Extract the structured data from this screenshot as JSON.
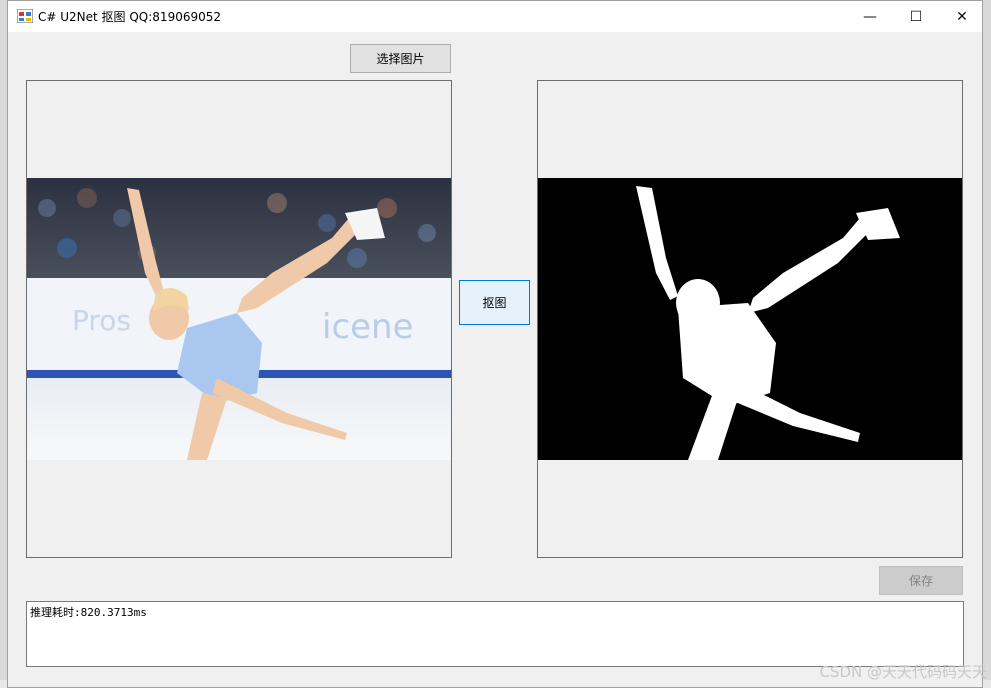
{
  "window": {
    "title": "C# U2Net 抠图 QQ:819069052",
    "controls": {
      "minimize": "—",
      "maximize": "☐",
      "close": "✕"
    }
  },
  "buttons": {
    "select_image": "选择图片",
    "matting": "抠图",
    "save": "保存"
  },
  "log": {
    "text": "推理耗时:820.3713ms"
  },
  "watermark": "CSDN @天天代码码天天",
  "colors": {
    "focus_border": "#0078d7",
    "mask_bg": "#000000",
    "mask_fg": "#ffffff"
  }
}
